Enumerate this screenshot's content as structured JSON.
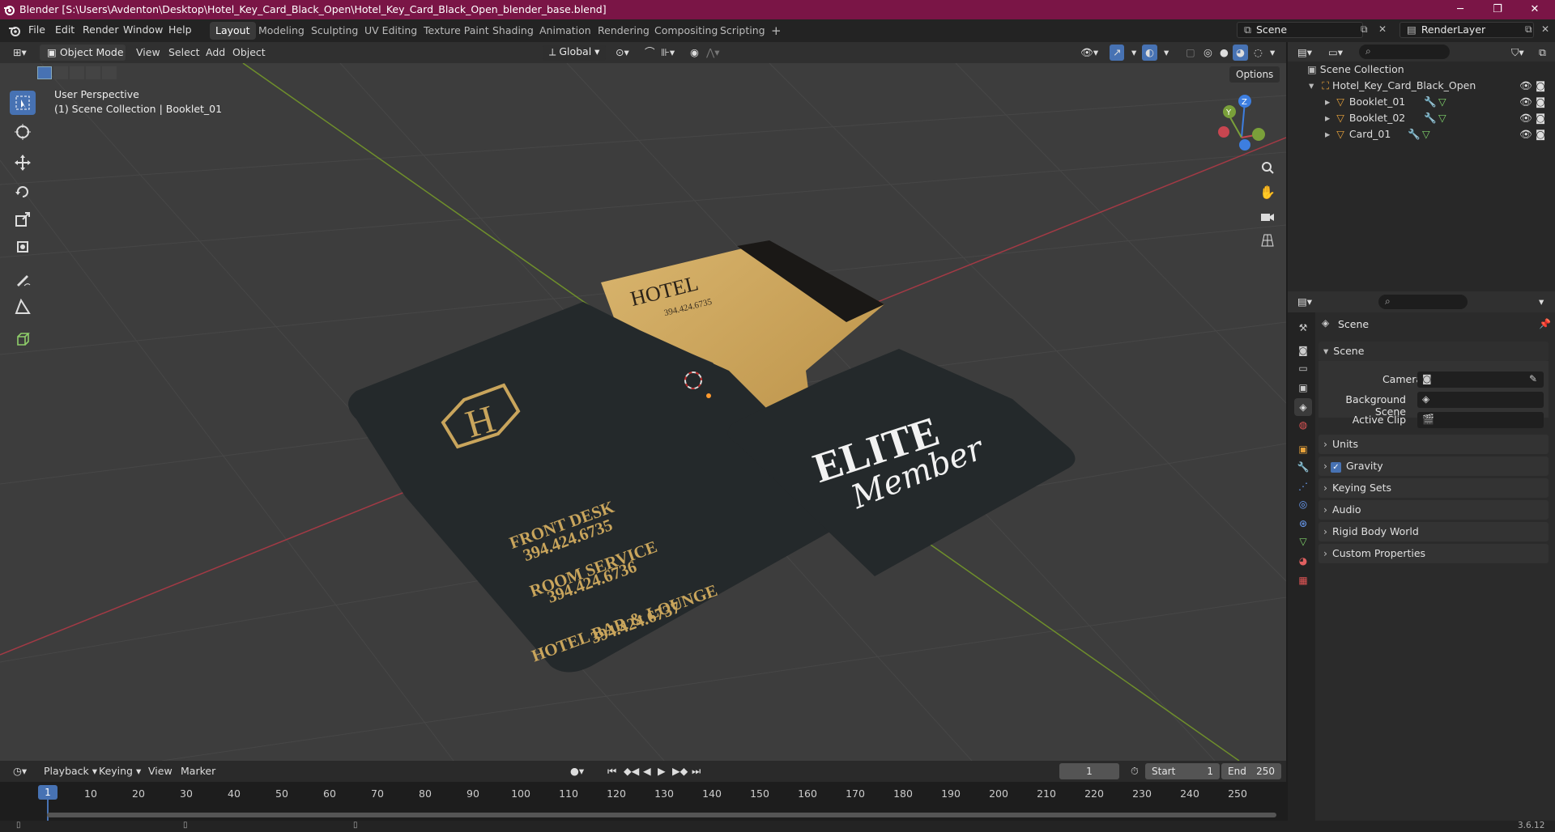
{
  "window": {
    "title": "Blender [S:\\Users\\Avdenton\\Desktop\\Hotel_Key_Card_Black_Open\\Hotel_Key_Card_Black_Open_blender_base.blend]"
  },
  "menus": [
    "File",
    "Edit",
    "Render",
    "Window",
    "Help"
  ],
  "workspaces": [
    "Layout",
    "Modeling",
    "Sculpting",
    "UV Editing",
    "Texture Paint",
    "Shading",
    "Animation",
    "Rendering",
    "Compositing",
    "Scripting"
  ],
  "scene": {
    "name": "Scene",
    "view_layer": "RenderLayer"
  },
  "viewport_header": {
    "mode": "Object Mode",
    "menus": [
      "View",
      "Select",
      "Add",
      "Object"
    ],
    "transform_orientation": "Global",
    "options": "Options"
  },
  "viewport": {
    "perspective": "User Perspective",
    "collection_info": "(1) Scene Collection | Booklet_01"
  },
  "card_textures": {
    "front_desk": "FRONT DESK",
    "front_desk_num": "394.424.6735",
    "room_service": "ROOM SERVICE",
    "room_service_num": "394.424.6736",
    "bar": "HOTEL BAR & LOUNGE",
    "bar_num": "394.424.6737",
    "logo_letter": "H",
    "hotel": "HOTEL",
    "hotel_num": "394.424.6735",
    "elite": "ELITE",
    "member": "Member"
  },
  "outliner": {
    "root": "Scene Collection",
    "collection": "Hotel_Key_Card_Black_Open",
    "objects": [
      "Booklet_01",
      "Booklet_02",
      "Card_01"
    ]
  },
  "properties": {
    "header": "Scene",
    "panel": "Scene",
    "camera_label": "Camera",
    "bg_label": "Background Scene",
    "clip_label": "Active Clip",
    "sections": [
      "Units",
      "Gravity",
      "Keying Sets",
      "Audio",
      "Rigid Body World",
      "Custom Properties"
    ],
    "gravity_checked": true
  },
  "timeline": {
    "menus": [
      "Playback",
      "Keying",
      "View",
      "Marker"
    ],
    "current_frame": "1",
    "start_label": "Start",
    "start": "1",
    "end_label": "End",
    "end": "250",
    "frame_marker": "1",
    "ticks": [
      "10",
      "20",
      "30",
      "40",
      "50",
      "60",
      "70",
      "80",
      "90",
      "100",
      "110",
      "120",
      "130",
      "140",
      "150",
      "160",
      "170",
      "180",
      "190",
      "200",
      "210",
      "220",
      "230",
      "240",
      "250"
    ]
  },
  "status": {
    "version": "3.6.12"
  },
  "colors": {
    "titlebar": "#7a1546",
    "active_blue": "#4772b3",
    "card_dark": "#24292b",
    "gold": "#c9a55c"
  }
}
